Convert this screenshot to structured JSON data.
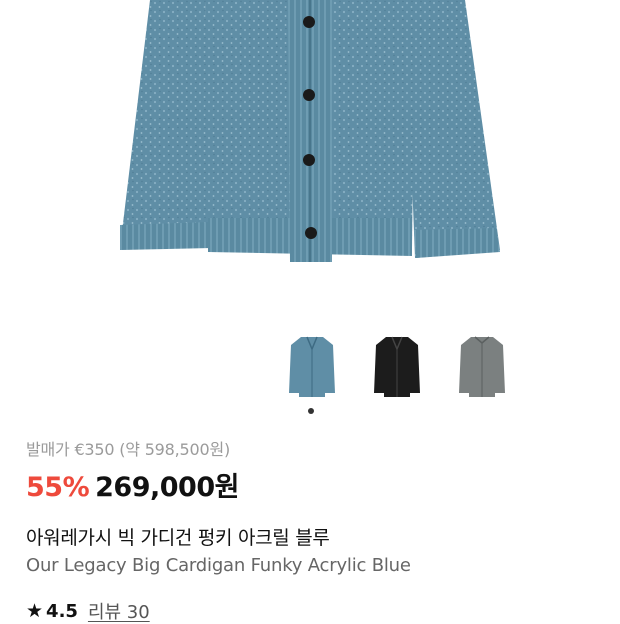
{
  "product": {
    "original_price": "발매가 €350 (약 598,500원)",
    "discount": "55%",
    "price": "269,000원",
    "name_ko": "아워레가시 빅 가디건 펑키 아크릴 블루",
    "name_en": "Our Legacy Big Cardigan Funky Acrylic Blue"
  },
  "rating": {
    "star_icon": "★",
    "score": "4.5",
    "reviews_label": "리뷰 30"
  },
  "gallery": {
    "selected_index": 0,
    "thumbnails": [
      "blue",
      "black",
      "gray"
    ]
  },
  "colors": {
    "discount": "#ee4a3c",
    "sweater_blue": "#5f8ea6",
    "sweater_black": "#1c1c1c",
    "sweater_gray": "#7b8080"
  }
}
